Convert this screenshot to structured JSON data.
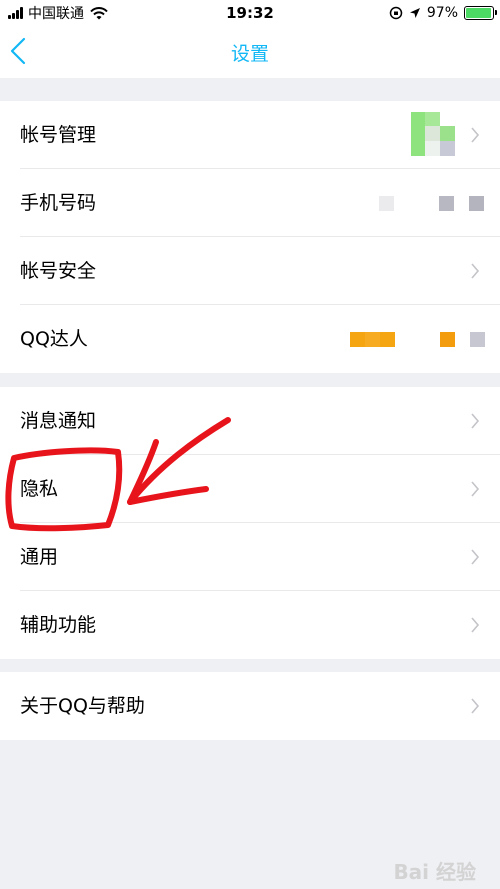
{
  "status_bar": {
    "carrier": "中国联通",
    "time": "19:32",
    "battery": "97%",
    "battery_level": 0.97
  },
  "nav": {
    "title": "设置"
  },
  "group1": [
    {
      "label": "帐号管理"
    },
    {
      "label": "手机号码"
    },
    {
      "label": "帐号安全"
    },
    {
      "label": "QQ达人"
    }
  ],
  "group2": [
    {
      "label": "消息通知"
    },
    {
      "label": "隐私"
    },
    {
      "label": "通用"
    },
    {
      "label": "辅助功能"
    }
  ],
  "group3": [
    {
      "label": "关于QQ与帮助"
    }
  ],
  "colors": {
    "accent": "#12b7f5",
    "annotation": "#e8141b",
    "battery": "#4cd964"
  },
  "watermark": "Bai 经验"
}
